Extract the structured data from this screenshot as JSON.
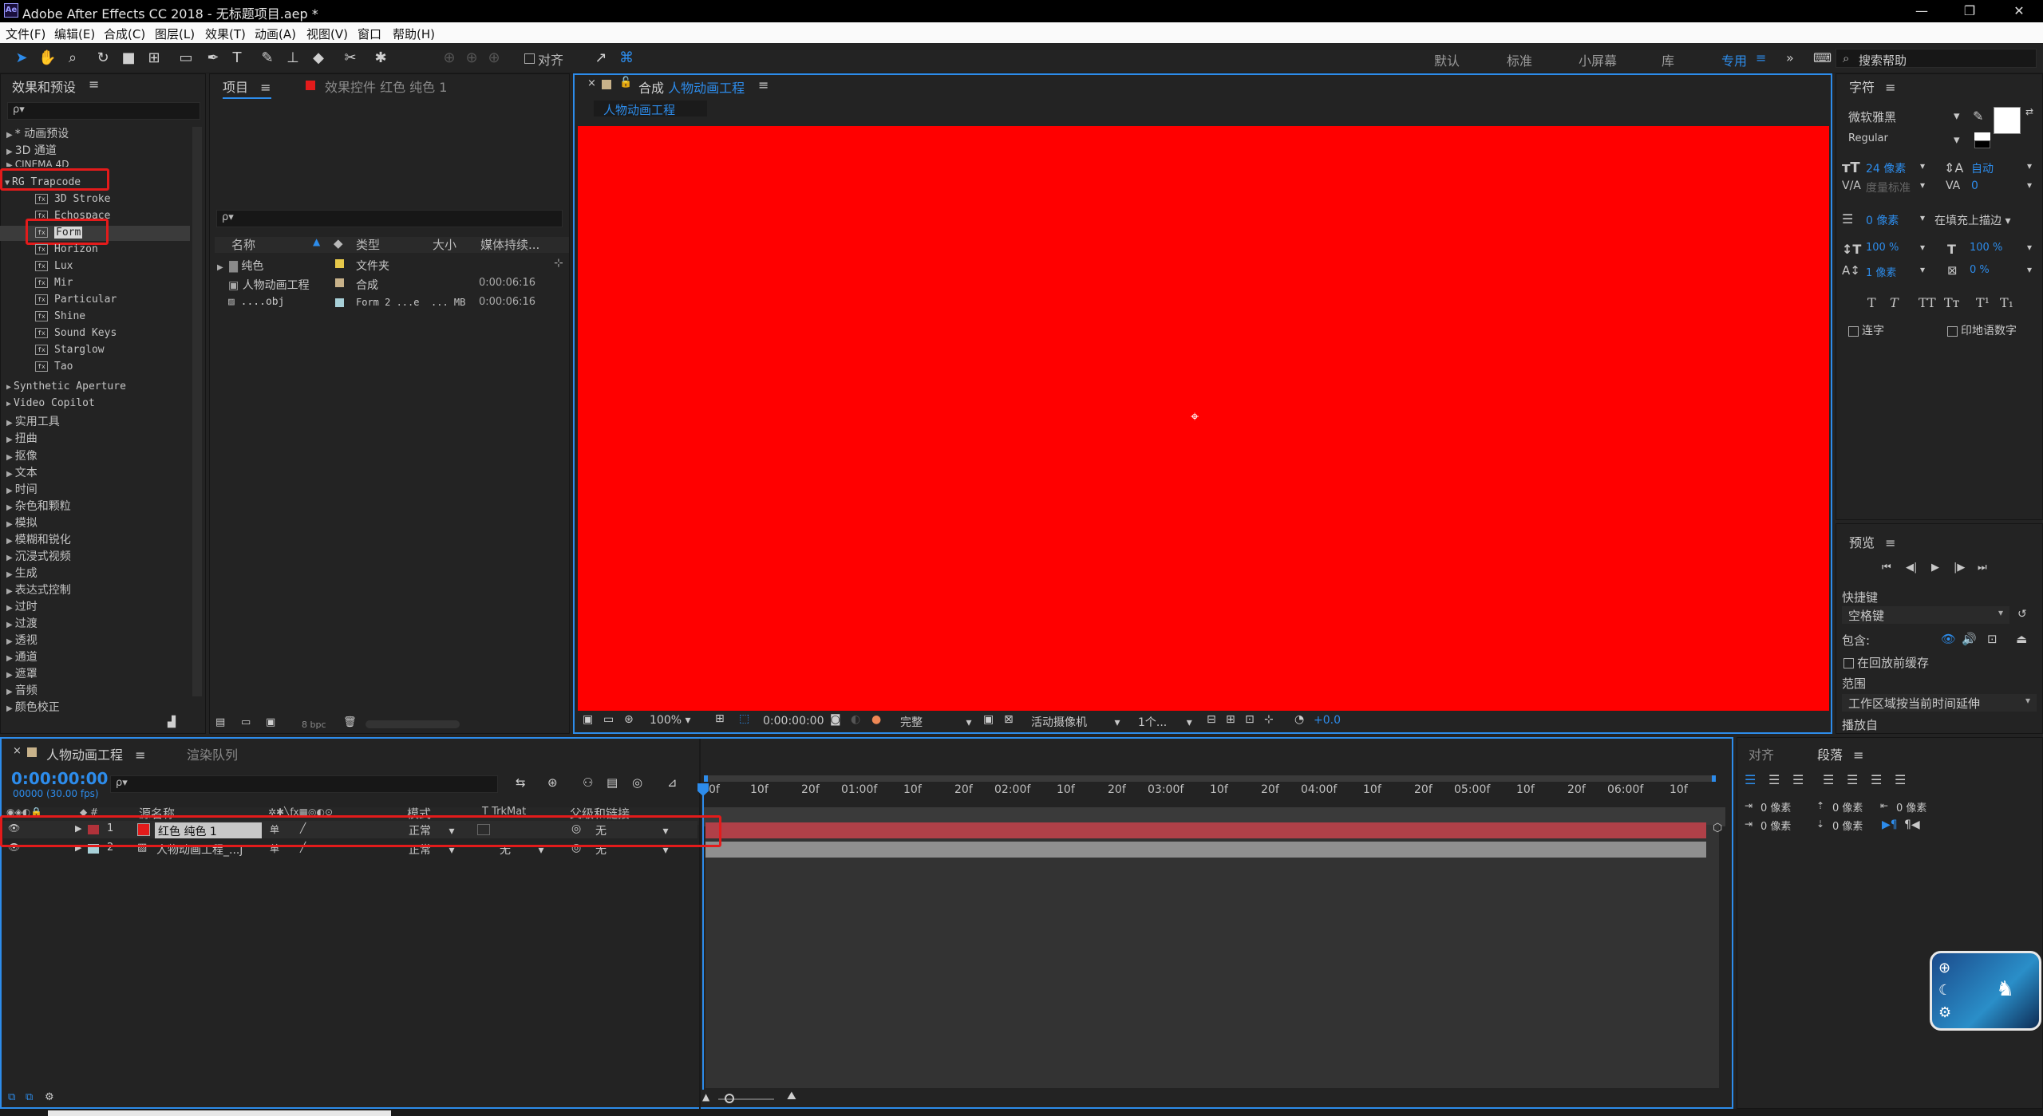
{
  "window": {
    "title": "Adobe After Effects CC 2018 - 无标题项目.aep *",
    "app_icon": "Ae",
    "minimize": "—",
    "maximize": "❐",
    "close": "✕"
  },
  "menu": [
    "文件(F)",
    "编辑(E)",
    "合成(C)",
    "图层(L)",
    "效果(T)",
    "动画(A)",
    "视图(V)",
    "窗口",
    "帮助(H)"
  ],
  "toolbar": {
    "align_label": "对齐",
    "workspaces": [
      "默认",
      "标准",
      "小屏幕",
      "库",
      "专用"
    ],
    "search_placeholder": "搜索帮助"
  },
  "effects_panel": {
    "title": "效果和预设",
    "search_placeholder": "ρ▾",
    "categories_top": [
      "* 动画预设",
      "3D 通道",
      "CINEMA 4D"
    ],
    "expanded": "RG Trapcode",
    "plugins": [
      "3D Stroke",
      "Echospace",
      "Form",
      "Horizon",
      "Lux",
      "Mir",
      "Particular",
      "Shine",
      "Sound Keys",
      "Starglow",
      "Tao"
    ],
    "categories_bottom": [
      "Synthetic Aperture",
      "Video Copilot",
      "实用工具",
      "扭曲",
      "抠像",
      "文本",
      "时间",
      "杂色和颗粒",
      "模拟",
      "模糊和锐化",
      "沉浸式视频",
      "生成",
      "表达式控制",
      "过时",
      "过渡",
      "透视",
      "通道",
      "遮罩",
      "音频",
      "颜色校正"
    ]
  },
  "project_panel": {
    "tab_project": "项目",
    "tab_effects": "效果控件 红色 纯色 1",
    "columns": [
      "名称",
      "类型",
      "大小",
      "媒体持续..."
    ],
    "items": [
      {
        "name": "纯色",
        "type": "文件夹",
        "size": "",
        "duration": "",
        "color": "#e6c84a"
      },
      {
        "name": "人物动画工程",
        "type": "合成",
        "size": "",
        "duration": "0:00:06:16",
        "color": "#c8b28a"
      },
      {
        "name": "....obj",
        "type": "Form 2 ...e",
        "size": "... MB",
        "duration": "0:00:06:16",
        "color": "#a8d0d8"
      }
    ],
    "bpc": "8 bpc"
  },
  "composition": {
    "tab_label": "合成",
    "comp_name": "人物动画工程",
    "subtab": "人物动画工程",
    "background": "#ff0000",
    "zoom": "100%",
    "timecode": "0:00:00:00",
    "quality": "完整",
    "camera": "活动摄像机",
    "views": "1个...",
    "exposure": "+0.0"
  },
  "character_panel": {
    "title": "字符",
    "font": "微软雅黑",
    "style": "Regular",
    "size": "24 像素",
    "leading": "自动",
    "kerning": "度量标准",
    "tracking": "0",
    "stroke_width": "0 像素",
    "stroke_type": "在填充上描边",
    "v_scale": "100 %",
    "h_scale": "100 %",
    "baseline": "1 像素",
    "tsume": "0 %",
    "styles": [
      "T",
      "T",
      "TT",
      "Tт",
      "T¹",
      "T₁"
    ],
    "ligatures": "连字",
    "hindi_digits": "印地语数字"
  },
  "preview_panel": {
    "title": "预览",
    "shortcut_label": "快捷键",
    "shortcut_value": "空格键",
    "include_label": "包含:",
    "cache_label": "在回放前缓存",
    "range_label": "范围",
    "range_value": "工作区域按当前时间延伸",
    "play_from_label": "播放自"
  },
  "timeline": {
    "tab_comp": "人物动画工程",
    "tab_render": "渲染队列",
    "timecode": "0:00:00:00",
    "frame_info": "00000 (30.00 fps)",
    "columns": {
      "source": "源名称",
      "mode": "模式",
      "trkmat": "T TrkMat",
      "parent": "父级和链接"
    },
    "ruler": [
      "0f",
      "10f",
      "20f",
      "01:00f",
      "10f",
      "20f",
      "02:00f",
      "10f",
      "20f",
      "03:00f",
      "10f",
      "20f",
      "04:00f",
      "10f",
      "20f",
      "05:00f",
      "10f",
      "20f",
      "06:00f",
      "10f"
    ],
    "layers": [
      {
        "num": "1",
        "name": "红色 纯色 1",
        "mode": "正常",
        "trkmat": "",
        "parent": "无",
        "color": "#e31b1b",
        "bar": "#b04048"
      },
      {
        "num": "2",
        "name": "人物动画工程_...j",
        "mode": "正常",
        "trkmat": "无",
        "parent": "无",
        "color": "#a8d0d8",
        "bar": "#8f8f8f"
      }
    ]
  },
  "align_panel": {
    "tab_align": "对齐",
    "tab_paragraph": "段落",
    "indent_values": [
      "0 像素",
      "0 像素",
      "0 像素",
      "0 像素",
      "0 像素"
    ]
  }
}
